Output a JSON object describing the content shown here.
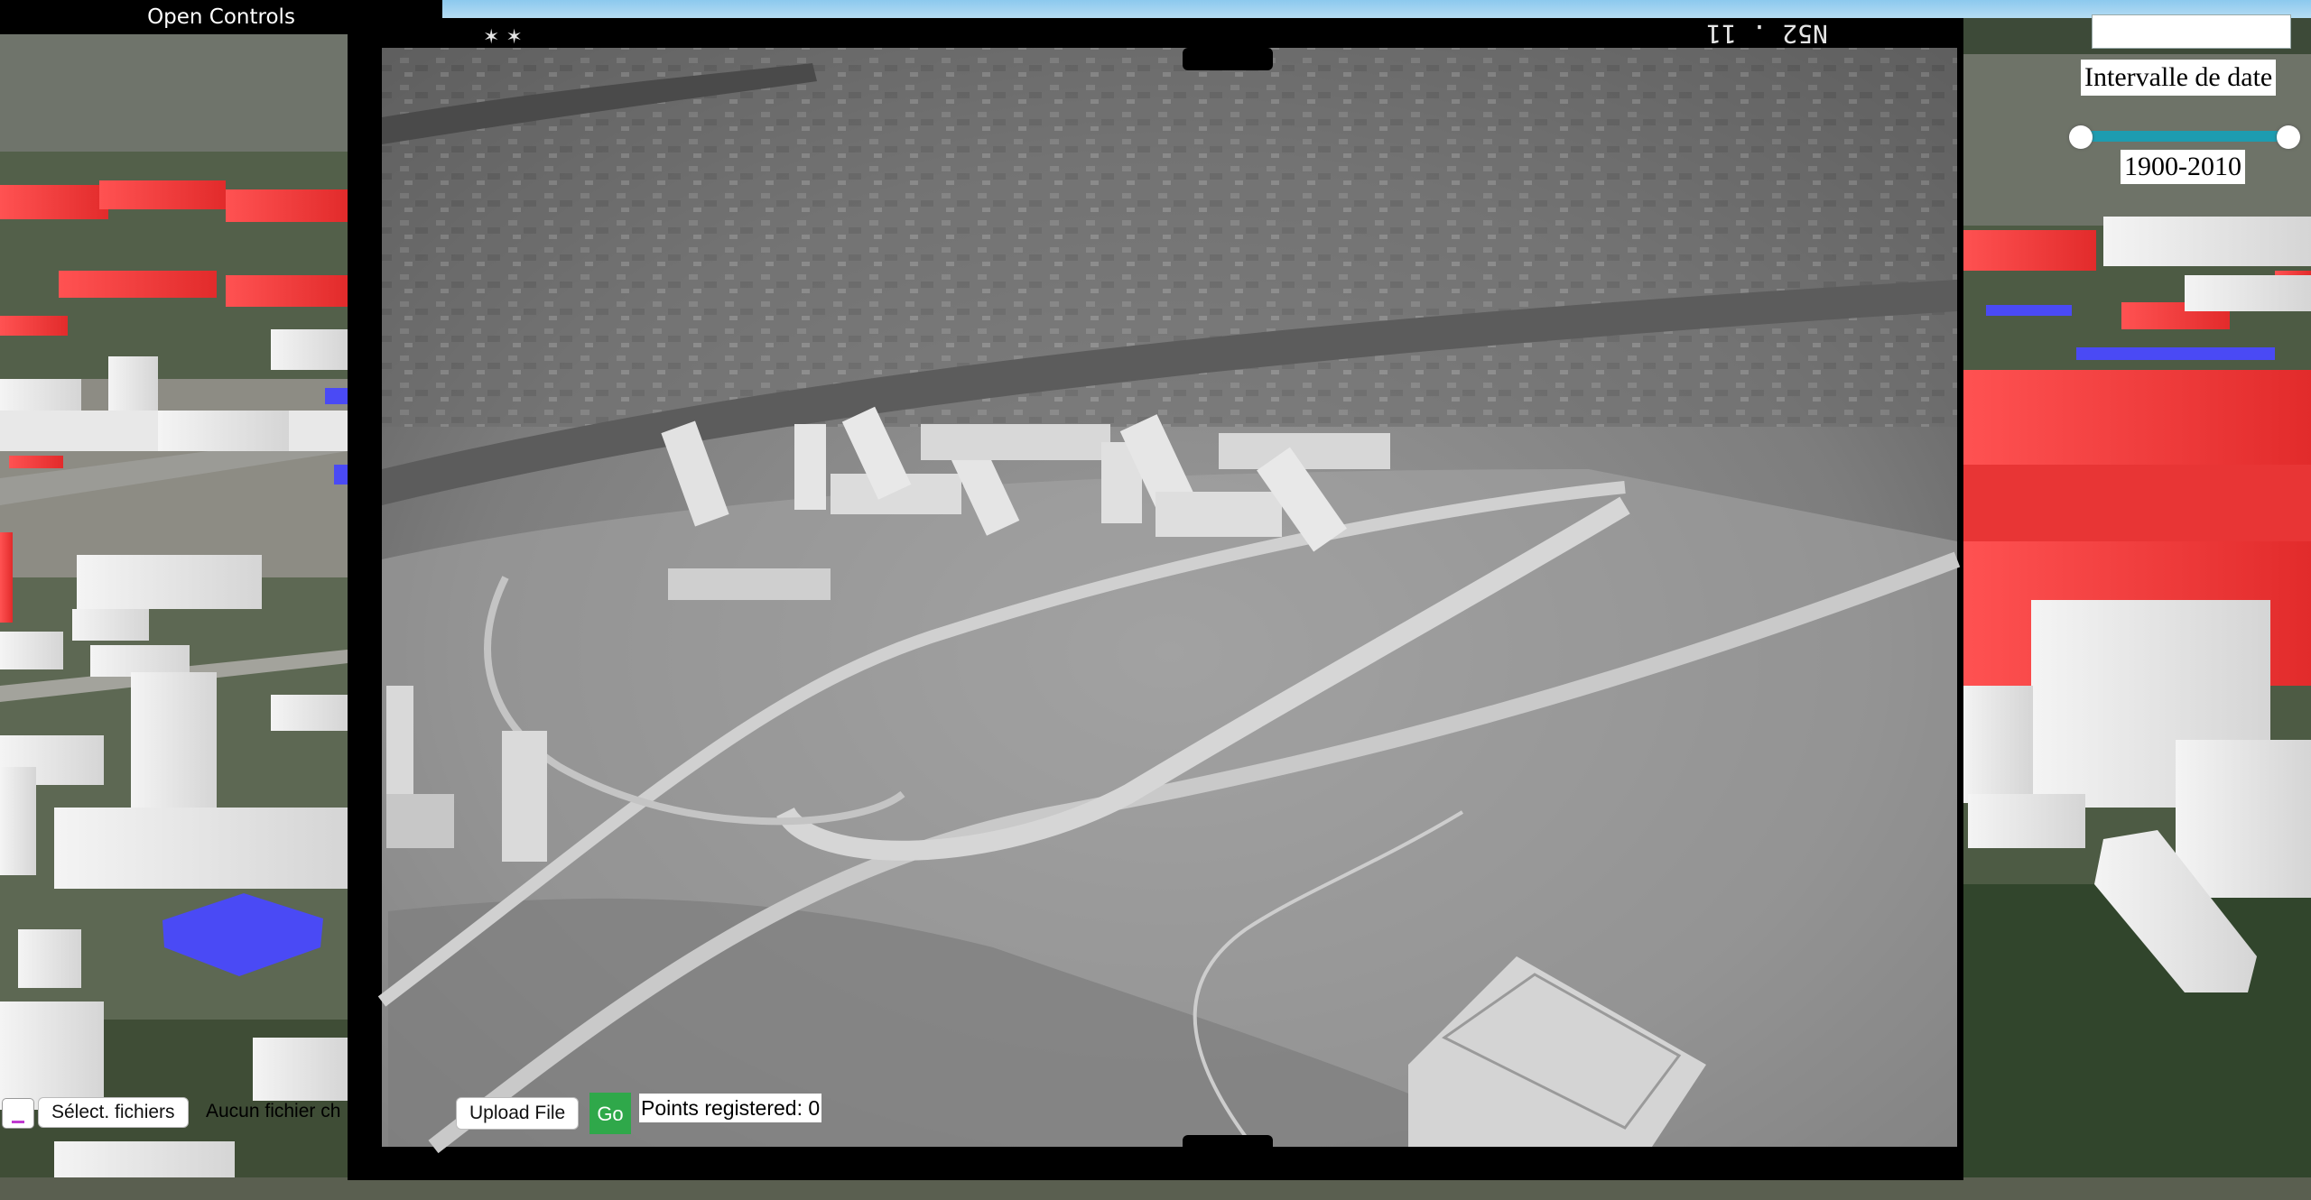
{
  "controls": {
    "open_label": "Open Controls"
  },
  "date_filter": {
    "input_value": "",
    "label": "Intervalle de date",
    "range_min": 1900,
    "range_max": 2010,
    "range_text": "1900-2010"
  },
  "file_picker": {
    "button_label": "Sélect. fichiers",
    "status": "Aucun fichier ch"
  },
  "photo_panel": {
    "upload_label": "Upload File",
    "go_label": "Go",
    "points_label": "Points registered: 0",
    "film_marking": "N52 . 11"
  },
  "colors": {
    "highlight_red": "#f23c3c",
    "highlight_blue": "#4a4af5",
    "go_green": "#2fa84a",
    "slider_track": "#1d9cb0"
  }
}
